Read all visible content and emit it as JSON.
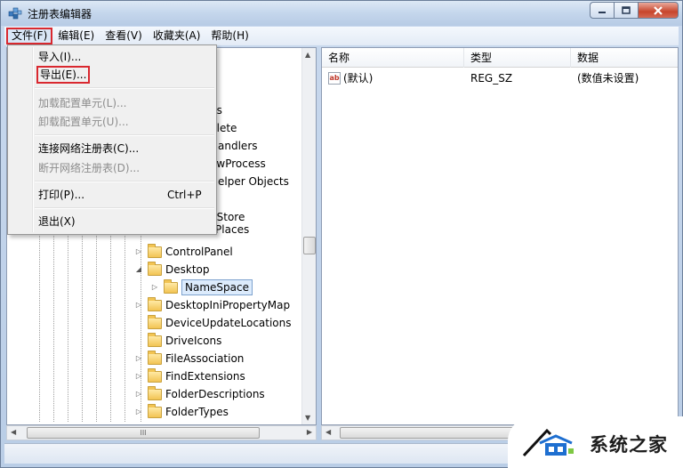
{
  "window": {
    "title": "注册表编辑器",
    "controls": {
      "minimize": "minimize-icon",
      "maximize": "maximize-icon",
      "close": "close-icon"
    }
  },
  "menubar": {
    "items": [
      "文件(F)",
      "编辑(E)",
      "查看(V)",
      "收藏夹(A)",
      "帮助(H)"
    ]
  },
  "file_menu": {
    "items": [
      {
        "label": "导入(I)...",
        "disabled": false
      },
      {
        "label": "导出(E)...",
        "disabled": false,
        "highlighted": true
      },
      {
        "label": "加载配置单元(L)...",
        "disabled": true
      },
      {
        "label": "卸载配置单元(U)...",
        "disabled": true
      },
      {
        "label": "连接网络注册表(C)...",
        "disabled": false
      },
      {
        "label": "断开网络注册表(D)...",
        "disabled": true
      },
      {
        "label": "打印(P)...",
        "disabled": false,
        "shortcut": "Ctrl+P"
      },
      {
        "label": "退出(X)",
        "disabled": false
      }
    ]
  },
  "tree": {
    "partial_rows": [
      "ns",
      "plete",
      "Handlers",
      "ewProcess",
      "Helper Objects",
      "g",
      "dStore",
      "CommonPlaces"
    ],
    "rows": [
      {
        "label": "ControlPanel",
        "expander": "▷"
      },
      {
        "label": "Desktop",
        "expander": "◢"
      },
      {
        "label": "NameSpace",
        "expander": "▷",
        "selected": true
      },
      {
        "label": "DesktopIniPropertyMap",
        "expander": "▷"
      },
      {
        "label": "DeviceUpdateLocations",
        "expander": ""
      },
      {
        "label": "DriveIcons",
        "expander": ""
      },
      {
        "label": "FileAssociation",
        "expander": "▷"
      },
      {
        "label": "FindExtensions",
        "expander": "▷"
      },
      {
        "label": "FolderDescriptions",
        "expander": "▷"
      },
      {
        "label": "FolderTypes",
        "expander": "▷"
      }
    ]
  },
  "list": {
    "columns": [
      "名称",
      "类型",
      "数据"
    ],
    "rows": [
      {
        "name": "(默认)",
        "type": "REG_SZ",
        "data": "(数值未设置)",
        "icon": "string-value-icon"
      }
    ],
    "icon_text": "ab"
  },
  "scrollbar_grip": "III",
  "watermark": {
    "text": "系统之家"
  },
  "colors": {
    "highlight_box": "#d9282f",
    "selection": "#dcebfc"
  }
}
